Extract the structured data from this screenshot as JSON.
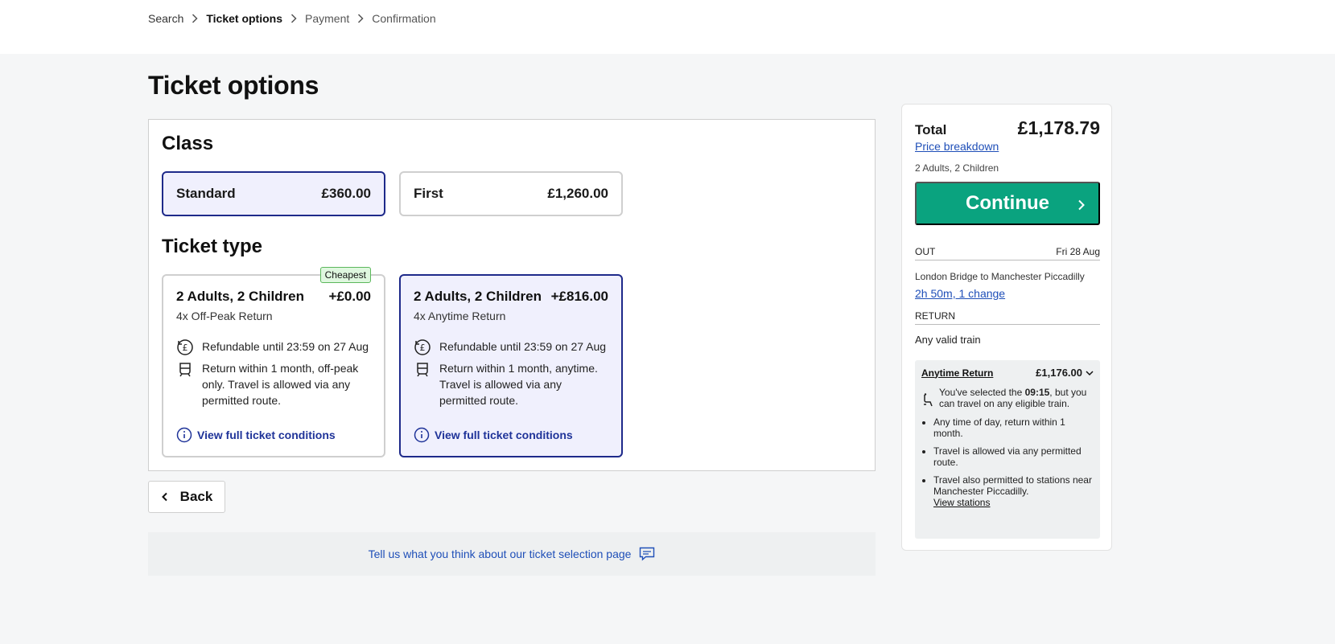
{
  "breadcrumb": {
    "items": [
      "Search",
      "Ticket options",
      "Payment",
      "Confirmation"
    ]
  },
  "page": {
    "title": "Ticket options"
  },
  "class_section": {
    "heading": "Class",
    "options": [
      {
        "label": "Standard",
        "price": "£360.00",
        "selected": true
      },
      {
        "label": "First",
        "price": "£1,260.00",
        "selected": false
      }
    ]
  },
  "ticket_section": {
    "heading": "Ticket type",
    "options": [
      {
        "passengers": "2 Adults, 2 Children",
        "price": "+£0.00",
        "ticket": "4x Off-Peak Return",
        "badge": "Cheapest",
        "refund": "Refundable until 23:59 on 27 Aug",
        "validity": "Return within 1 month, off-peak only. Travel is allowed via any permitted route.",
        "link": "View full ticket conditions",
        "selected": false
      },
      {
        "passengers": "2 Adults, 2 Children",
        "price": "+£816.00",
        "ticket": "4x Anytime Return",
        "refund": "Refundable until 23:59 on 27 Aug",
        "validity": "Return within 1 month, anytime. Travel is allowed via any permitted route.",
        "link": "View full ticket conditions",
        "selected": true
      }
    ]
  },
  "back": {
    "label": "Back"
  },
  "feedback": {
    "text": "Tell us what you think about our ticket selection page"
  },
  "summary": {
    "total_label": "Total",
    "total_value": "£1,178.79",
    "price_breakdown": "Price breakdown",
    "passengers": "2 Adults, 2 Children",
    "continue_label": "Continue",
    "out": {
      "label": "OUT",
      "date": "Fri 28 Aug",
      "route": "London Bridge to Manchester Piccadilly",
      "duration": "2h 50m, 1 change"
    },
    "return": {
      "label": "RETURN",
      "train": "Any valid train",
      "ticket_name": "Anytime Return",
      "ticket_price": "£1,176.00",
      "note_pre": "You've selected the ",
      "note_time": "09:15",
      "note_post": ", but you can travel on any eligible train.",
      "bullets": [
        "Any time of day, return within 1 month.",
        "Travel is allowed via any permitted route.",
        "Travel also permitted to stations near Manchester Piccadilly."
      ],
      "view_stations": "View stations"
    }
  },
  "colors": {
    "accent": "#0aa37f",
    "selected_border": "#1e2a8a",
    "selected_bg": "#f0f0fd",
    "link": "#1f4fb8"
  }
}
